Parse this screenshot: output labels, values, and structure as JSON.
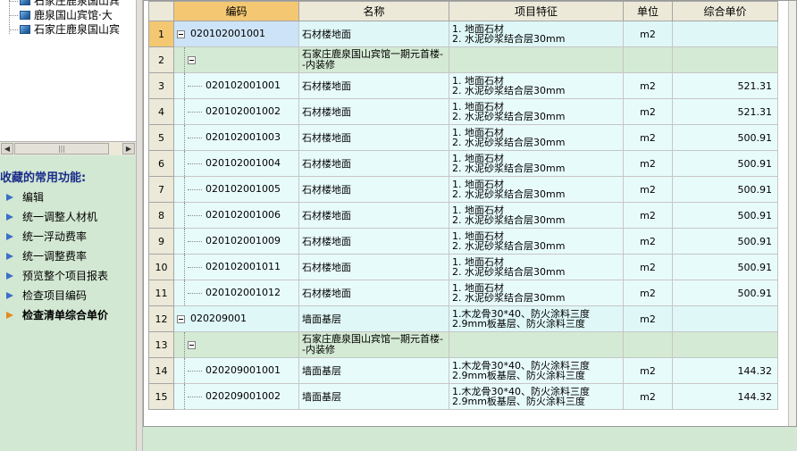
{
  "tree": {
    "items": [
      {
        "label": "石家庄鹿泉国山宾"
      },
      {
        "label": "鹿泉国山宾馆·大"
      },
      {
        "label": "石家庄鹿泉国山宾"
      }
    ],
    "scroll_thumb_glyph": "|||"
  },
  "favorites": {
    "title": "我收藏的常用功能:",
    "items": [
      {
        "label": "编辑",
        "active": false
      },
      {
        "label": "统一调整人材机",
        "active": false
      },
      {
        "label": "统一浮动费率",
        "active": false
      },
      {
        "label": "统一调整费率",
        "active": false
      },
      {
        "label": "预览整个项目报表",
        "active": false
      },
      {
        "label": "检查项目编码",
        "active": false
      },
      {
        "label": "检查清单综合单价",
        "active": true
      }
    ]
  },
  "grid": {
    "columns": [
      "编码",
      "名称",
      "项目特征",
      "单位",
      "综合单价"
    ],
    "rows": [
      {
        "num": "1",
        "level": 1,
        "selected": true,
        "expander": true,
        "code": "020102001001",
        "name": "石材楼地面",
        "feature": [
          "1. 地面石材",
          "2. 水泥砂浆结合层30mm"
        ],
        "unit": "m2",
        "price": ""
      },
      {
        "num": "2",
        "level": 2,
        "selected": false,
        "expander": true,
        "code": "",
        "name": "石家庄鹿泉国山宾馆一期元首楼--内装修",
        "feature": [],
        "unit": "",
        "price": ""
      },
      {
        "num": "3",
        "level": 3,
        "selected": false,
        "expander": false,
        "code": "020102001001",
        "name": "石材楼地面",
        "feature": [
          "1. 地面石材",
          "2. 水泥砂浆结合层30mm"
        ],
        "unit": "m2",
        "price": "521.31"
      },
      {
        "num": "4",
        "level": 3,
        "selected": false,
        "expander": false,
        "code": "020102001002",
        "name": "石材楼地面",
        "feature": [
          "1. 地面石材",
          "2. 水泥砂浆结合层30mm"
        ],
        "unit": "m2",
        "price": "521.31"
      },
      {
        "num": "5",
        "level": 3,
        "selected": false,
        "expander": false,
        "code": "020102001003",
        "name": "石材楼地面",
        "feature": [
          "1. 地面石材",
          "2. 水泥砂浆结合层30mm"
        ],
        "unit": "m2",
        "price": "500.91"
      },
      {
        "num": "6",
        "level": 3,
        "selected": false,
        "expander": false,
        "code": "020102001004",
        "name": "石材楼地面",
        "feature": [
          "1. 地面石材",
          "2. 水泥砂浆结合层30mm"
        ],
        "unit": "m2",
        "price": "500.91"
      },
      {
        "num": "7",
        "level": 3,
        "selected": false,
        "expander": false,
        "code": "020102001005",
        "name": "石材楼地面",
        "feature": [
          "1. 地面石材",
          "2. 水泥砂浆结合层30mm"
        ],
        "unit": "m2",
        "price": "500.91"
      },
      {
        "num": "8",
        "level": 3,
        "selected": false,
        "expander": false,
        "code": "020102001006",
        "name": "石材楼地面",
        "feature": [
          "1. 地面石材",
          "2. 水泥砂浆结合层30mm"
        ],
        "unit": "m2",
        "price": "500.91"
      },
      {
        "num": "9",
        "level": 3,
        "selected": false,
        "expander": false,
        "code": "020102001009",
        "name": "石材楼地面",
        "feature": [
          "1. 地面石材",
          "2. 水泥砂浆结合层30mm"
        ],
        "unit": "m2",
        "price": "500.91"
      },
      {
        "num": "10",
        "level": 3,
        "selected": false,
        "expander": false,
        "code": "020102001011",
        "name": "石材楼地面",
        "feature": [
          "1. 地面石材",
          "2. 水泥砂浆结合层30mm"
        ],
        "unit": "m2",
        "price": "500.91"
      },
      {
        "num": "11",
        "level": 3,
        "selected": false,
        "expander": false,
        "code": "020102001012",
        "name": "石材楼地面",
        "feature": [
          "1. 地面石材",
          "2. 水泥砂浆结合层30mm"
        ],
        "unit": "m2",
        "price": "500.91"
      },
      {
        "num": "12",
        "level": 1,
        "selected": false,
        "expander": true,
        "code": "020209001",
        "name": "墙面基层",
        "feature": [
          "1.木龙骨30*40、防火涂料三度",
          "2.9mm板基层、防火涂料三度"
        ],
        "unit": "m2",
        "price": ""
      },
      {
        "num": "13",
        "level": 2,
        "selected": false,
        "expander": true,
        "code": "",
        "name": "石家庄鹿泉国山宾馆一期元首楼--内装修",
        "feature": [],
        "unit": "",
        "price": ""
      },
      {
        "num": "14",
        "level": 3,
        "selected": false,
        "expander": false,
        "code": "020209001001",
        "name": "墙面基层",
        "feature": [
          "1.木龙骨30*40、防火涂料三度",
          "2.9mm板基层、防火涂料三度"
        ],
        "unit": "m2",
        "price": "144.32"
      },
      {
        "num": "15",
        "level": 3,
        "selected": false,
        "expander": false,
        "code": "020209001002",
        "name": "墙面基层",
        "feature": [
          "1.木龙骨30*40、防火涂料三度",
          "2.9mm板基层、防火涂料三度"
        ],
        "unit": "m2",
        "price": "144.32"
      }
    ]
  }
}
